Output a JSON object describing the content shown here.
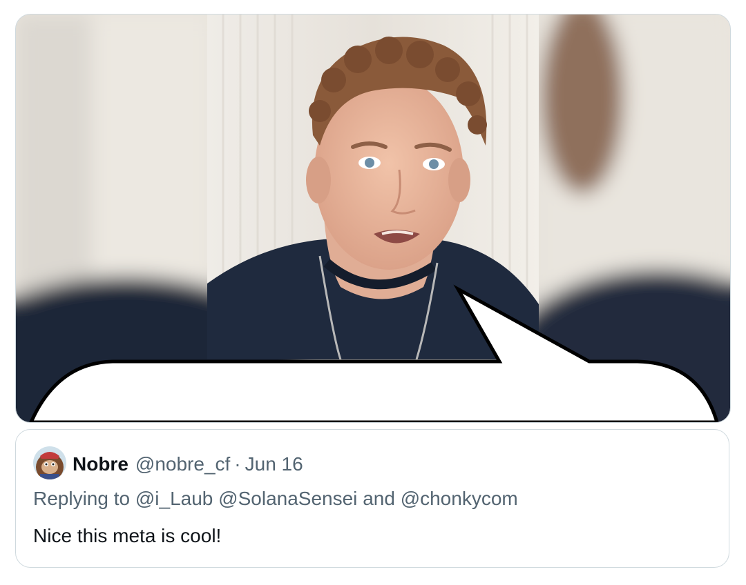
{
  "media": {
    "alt": "video still of a man speaking with a comic speech bubble overlay",
    "colors": {
      "background": "#e9e4dc",
      "curtain": "#f3f0eb",
      "skin": "#e8b79e",
      "hair": "#8a5a3a",
      "shirt": "#1f2a3e",
      "bubble_fill": "#ffffff",
      "bubble_stroke": "#000000"
    }
  },
  "quote": {
    "avatar_icon": "ape-avatar-icon",
    "display_name": "Nobre",
    "handle": "@nobre_cf",
    "separator": "·",
    "date": "Jun 16",
    "reply_prefix": "Replying to",
    "mentions": [
      "@i_Laub",
      "@SolanaSensei"
    ],
    "reply_conjunction": "and",
    "last_mention": "@chonkycom",
    "text": "Nice this meta is cool!"
  },
  "colors": {
    "border": "#cfd9de",
    "primary_text": "#0f1419",
    "secondary_text": "#536471"
  }
}
